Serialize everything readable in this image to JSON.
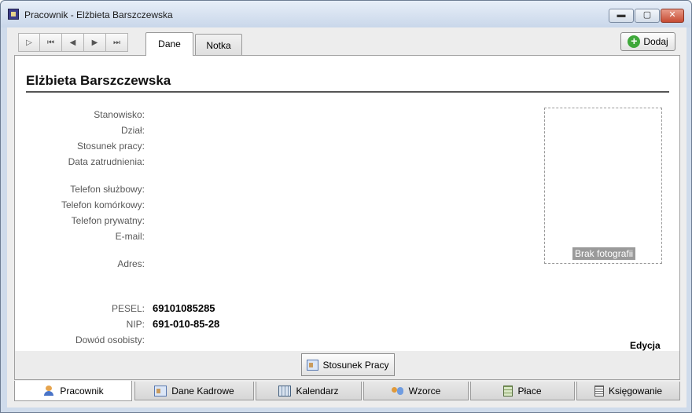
{
  "window": {
    "title": "Pracownik - Elżbieta Barszczewska",
    "minimize_glyph": "▬",
    "maximize_glyph": "▢",
    "close_glyph": "✕"
  },
  "navigator": {
    "buttons": [
      {
        "name": "new-record-button",
        "glyph": "▷"
      },
      {
        "name": "first-record-button",
        "glyph": "⏮"
      },
      {
        "name": "previous-record-button",
        "glyph": "◀"
      },
      {
        "name": "next-record-button",
        "glyph": "▶"
      },
      {
        "name": "last-record-button",
        "glyph": "⏭"
      }
    ]
  },
  "tabs": {
    "dane": "Dane",
    "notka": "Notka",
    "active": "Dane"
  },
  "toolbar": {
    "add_label": "Dodaj",
    "add_glyph": "+"
  },
  "person": {
    "name": "Elżbieta Barszczewska",
    "fields": {
      "stanowisko": {
        "label": "Stanowisko:",
        "value": ""
      },
      "dzial": {
        "label": "Dział:",
        "value": ""
      },
      "stosunek": {
        "label": "Stosunek pracy:",
        "value": ""
      },
      "data_zatrudnienia": {
        "label": "Data zatrudnienia:",
        "value": ""
      },
      "tel_sluzbowy": {
        "label": "Telefon służbowy:",
        "value": ""
      },
      "tel_komorkowy": {
        "label": "Telefon komórkowy:",
        "value": ""
      },
      "tel_prywatny": {
        "label": "Telefon prywatny:",
        "value": ""
      },
      "email": {
        "label": "E-mail:",
        "value": ""
      },
      "adres": {
        "label": "Adres:",
        "value": ""
      },
      "pesel": {
        "label": "PESEL:",
        "value": "69101085285"
      },
      "nip": {
        "label": "NIP:",
        "value": "691-010-85-28"
      },
      "dowod": {
        "label": "Dowód osobisty:",
        "value": ""
      }
    },
    "photo_caption": "Brak fotografii",
    "edit_label": "Edycja"
  },
  "actions": {
    "stosunek_pracy": "Stosunek Pracy"
  },
  "bottom_tabs": [
    {
      "label": "Pracownik",
      "icon": "person-icon"
    },
    {
      "label": "Dane Kadrowe",
      "icon": "id-card-icon"
    },
    {
      "label": "Kalendarz",
      "icon": "calendar-icon"
    },
    {
      "label": "Wzorce",
      "icon": "people-icon"
    },
    {
      "label": "Płace",
      "icon": "calculator-icon"
    },
    {
      "label": "Księgowanie",
      "icon": "ledger-icon"
    }
  ]
}
